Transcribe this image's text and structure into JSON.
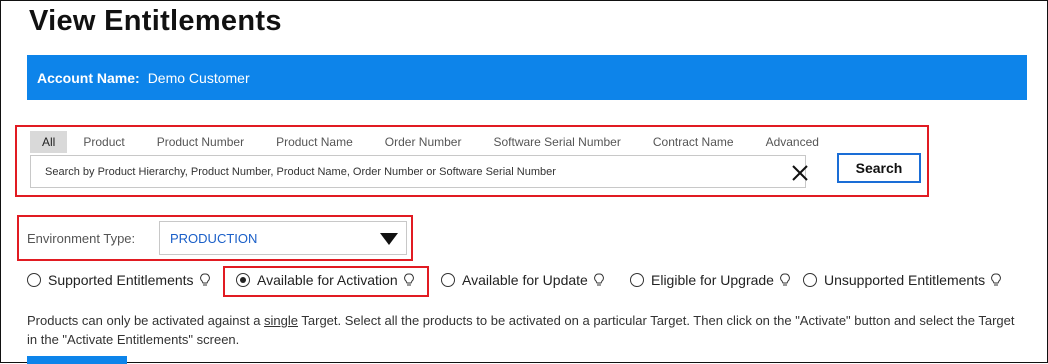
{
  "page": {
    "title": "View Entitlements"
  },
  "account": {
    "label": "Account Name:",
    "value": "Demo Customer"
  },
  "search": {
    "tabs": [
      {
        "label": "All",
        "active": true
      },
      {
        "label": "Product"
      },
      {
        "label": "Product Number"
      },
      {
        "label": "Product Name"
      },
      {
        "label": "Order Number"
      },
      {
        "label": "Software Serial Number"
      },
      {
        "label": "Contract Name"
      },
      {
        "label": "Advanced"
      }
    ],
    "placeholder": "Search by Product Hierarchy, Product Number, Product Name, Order Number or Software Serial Number",
    "button_label": "Search",
    "clear_icon": "close-x-icon"
  },
  "environment": {
    "label": "Environment Type:",
    "selected": "PRODUCTION"
  },
  "filters": [
    {
      "label": "Supported Entitlements",
      "checked": false
    },
    {
      "label": "Available for Activation",
      "checked": true
    },
    {
      "label": "Available for Update",
      "checked": false
    },
    {
      "label": "Eligible for Upgrade",
      "checked": false
    },
    {
      "label": "Unsupported Entitlements",
      "checked": false
    }
  ],
  "note": {
    "part1": "Products can only be activated against a ",
    "emphasis": "single",
    "part2": " Target.  Select all the products to be activated on a particular Target.  Then click on the \"Activate\" button and select the Target in the \"Activate Entitlements\" screen."
  },
  "colors": {
    "accent": "#0d84ea",
    "highlight": "#e11b22",
    "link": "#1a5fc8"
  }
}
